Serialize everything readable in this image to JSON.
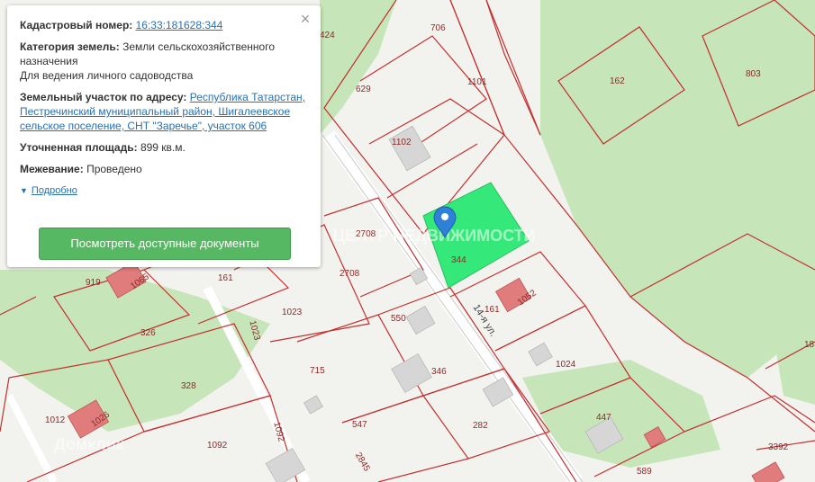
{
  "popup": {
    "cadastral_label": "Кадастровый номер:",
    "cadastral_number": "16:33:181628:344",
    "category_label": "Категория земель:",
    "category_value": "Земли сельскохозяйственного назначения",
    "usage_value": "Для ведения личного садоводства",
    "address_label": "Земельный участок по адресу:",
    "address_value": "Республика Татарстан, Пестречинский муниципальный район, Шигалеевское сельское поселение, СНТ \"Заречье\", участок 606",
    "area_label": "Уточненная площадь:",
    "area_value": "899 кв.м.",
    "survey_label": "Межевание:",
    "survey_value": "Проведено",
    "details_link": "Подробно",
    "documents_button": "Посмотреть доступные документы",
    "close_icon": "close-icon"
  },
  "map": {
    "street_label": "14-я ул.",
    "selected_plot": "344",
    "selected_color": "#35e87a",
    "plot_labels": [
      "706",
      "1101",
      "162",
      "803",
      "629",
      "1102",
      "424",
      "2708",
      "2708",
      "161",
      "919",
      "1065",
      "1023",
      "550",
      "161",
      "1052",
      "326",
      "1023",
      "715",
      "346",
      "1024",
      "328",
      "1012",
      "1026",
      "547",
      "282",
      "447",
      "1092",
      "1092",
      "3392",
      "589",
      "2845",
      "18"
    ],
    "watermark_brand": "Домклик",
    "watermark_text": "ЦЕНТР НЕДВИЖИМОСТИ",
    "colors": {
      "forest": "#c6e5b8",
      "boundary": "#c42f2f",
      "building": "#d6d6d6",
      "highlight_building": "#e07c7c"
    }
  }
}
